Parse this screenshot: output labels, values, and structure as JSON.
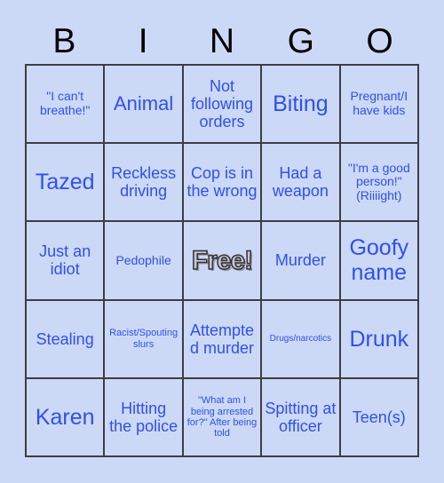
{
  "header": {
    "letters": [
      "B",
      "I",
      "N",
      "G",
      "O"
    ]
  },
  "colors": {
    "background": "#ccd9f6",
    "cell_background": "#ccd9f6",
    "grid_line": "#3d3d47",
    "header_text": "#000000",
    "cell_text": "#2f4ff0",
    "free_fill": "#c8c4d8",
    "free_outline": "#333333"
  },
  "grid": {
    "rows": 5,
    "columns": 5,
    "cells": [
      {
        "text": "\"I can't breathe!\"",
        "size": "sz-sm",
        "free": false
      },
      {
        "text": "Animal",
        "size": "sz-lg",
        "free": false
      },
      {
        "text": "Not following orders",
        "size": "sz-md",
        "free": false
      },
      {
        "text": "Biting",
        "size": "sz-xl",
        "free": false
      },
      {
        "text": "Pregnant/I have kids",
        "size": "sz-sm",
        "free": false
      },
      {
        "text": "Tazed",
        "size": "sz-xl",
        "free": false
      },
      {
        "text": "Reckless driving",
        "size": "sz-md",
        "free": false
      },
      {
        "text": "Cop is in the wrong",
        "size": "sz-md",
        "free": false
      },
      {
        "text": "Had a weapon",
        "size": "sz-md",
        "free": false
      },
      {
        "text": "\"I'm a good person!\" (Riiiight)",
        "size": "sz-sm",
        "free": false
      },
      {
        "text": "Just an idiot",
        "size": "sz-md",
        "free": false
      },
      {
        "text": "Pedophile",
        "size": "sz-sm",
        "free": false
      },
      {
        "text": "Free!",
        "size": "sz-xl",
        "free": true
      },
      {
        "text": "Murder",
        "size": "sz-md",
        "free": false
      },
      {
        "text": "Goofy name",
        "size": "sz-xl",
        "free": false
      },
      {
        "text": "Stealing",
        "size": "sz-md",
        "free": false
      },
      {
        "text": "Racist/Spouting slurs",
        "size": "sz-xs",
        "free": false
      },
      {
        "text": "Attempted murder",
        "size": "sz-md",
        "free": false
      },
      {
        "text": "Drugs/narcotics",
        "size": "sz-xxs",
        "free": false
      },
      {
        "text": "Drunk",
        "size": "sz-xl",
        "free": false
      },
      {
        "text": "Karen",
        "size": "sz-xl",
        "free": false
      },
      {
        "text": "Hitting the police",
        "size": "sz-md",
        "free": false
      },
      {
        "text": "\"What am I being arrested for?\" After being told",
        "size": "sz-xs",
        "free": false
      },
      {
        "text": "Spitting at officer",
        "size": "sz-md",
        "free": false
      },
      {
        "text": "Teen(s)",
        "size": "sz-md",
        "free": false
      }
    ]
  }
}
